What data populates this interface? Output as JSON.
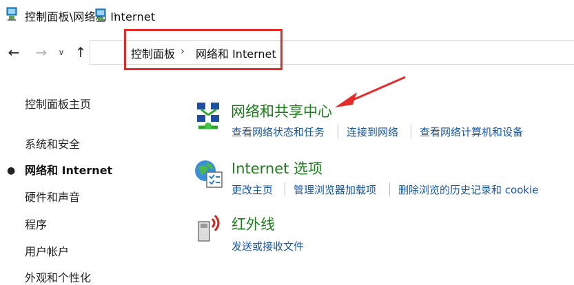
{
  "window": {
    "title": "控制面板\\网络和 Internet"
  },
  "address": {
    "crumbs": [
      "控制面板",
      "网络和 Internet"
    ]
  },
  "sidebar": {
    "items": [
      {
        "label": "控制面板主页"
      },
      {
        "label": "系统和安全"
      },
      {
        "label": "网络和 Internet",
        "active": true
      },
      {
        "label": "硬件和声音"
      },
      {
        "label": "程序"
      },
      {
        "label": "用户帐户"
      },
      {
        "label": "外观和个性化"
      }
    ]
  },
  "categories": [
    {
      "title": "网络和共享中心",
      "icon": "network-sharing-icon",
      "links": [
        "查看网络状态和任务",
        "连接到网络",
        "查看网络计算机和设备"
      ]
    },
    {
      "title": "Internet 选项",
      "icon": "internet-options-icon",
      "links": [
        "更改主页",
        "管理浏览器加载项",
        "删除浏览的历史记录和 cookie"
      ]
    },
    {
      "title": "红外线",
      "icon": "infrared-icon",
      "links": [
        "发送或接收文件"
      ]
    }
  ],
  "colors": {
    "category_title": "#1a7f1a",
    "link": "#1757a8",
    "highlight": "#e52a2a"
  }
}
